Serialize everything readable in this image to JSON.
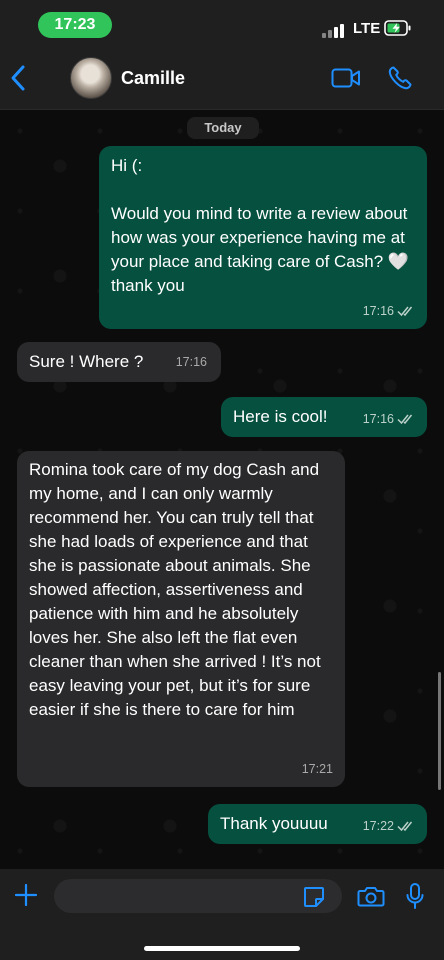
{
  "status_bar": {
    "time": "17:23",
    "network": "LTE",
    "battery_state": "charging",
    "accent_color": "#31c45a"
  },
  "header": {
    "contact_name": "Camille",
    "icons": [
      "chevron-left-icon",
      "avatar",
      "video-call-icon",
      "phone-icon"
    ],
    "accent_color": "#1f8fff"
  },
  "chat": {
    "day_label": "Today",
    "messages": [
      {
        "direction": "outgoing",
        "text": "Hi (:\n\nWould you mind to write a review about how was your experience having me at your place and taking care of Cash? 🤍 thank you",
        "time": "17:16",
        "status": "read"
      },
      {
        "direction": "incoming",
        "text": "Sure ! Where ?",
        "time": "17:16"
      },
      {
        "direction": "outgoing",
        "text": "Here is cool!",
        "time": "17:16",
        "status": "read"
      },
      {
        "direction": "incoming",
        "text": "Romina took care of my dog Cash and my home, and I can only warmly recommend her. You can truly tell that she had loads of experience and that she is passionate about animals. She showed affection, assertiveness and patience with him and he absolutely loves her. She also left the flat even cleaner than when she arrived ! It’s not easy leaving your pet, but it’s for sure easier if she is there to care for him",
        "time": "17:21"
      },
      {
        "direction": "outgoing",
        "text": "Thank youuuu",
        "time": "17:22",
        "status": "read"
      }
    ],
    "colors": {
      "outgoing": "#06503f",
      "incoming": "#2a2a2c"
    }
  },
  "composer": {
    "input_value": "",
    "icons": [
      "plus-icon",
      "sticker-icon",
      "camera-icon",
      "microphone-icon"
    ]
  }
}
